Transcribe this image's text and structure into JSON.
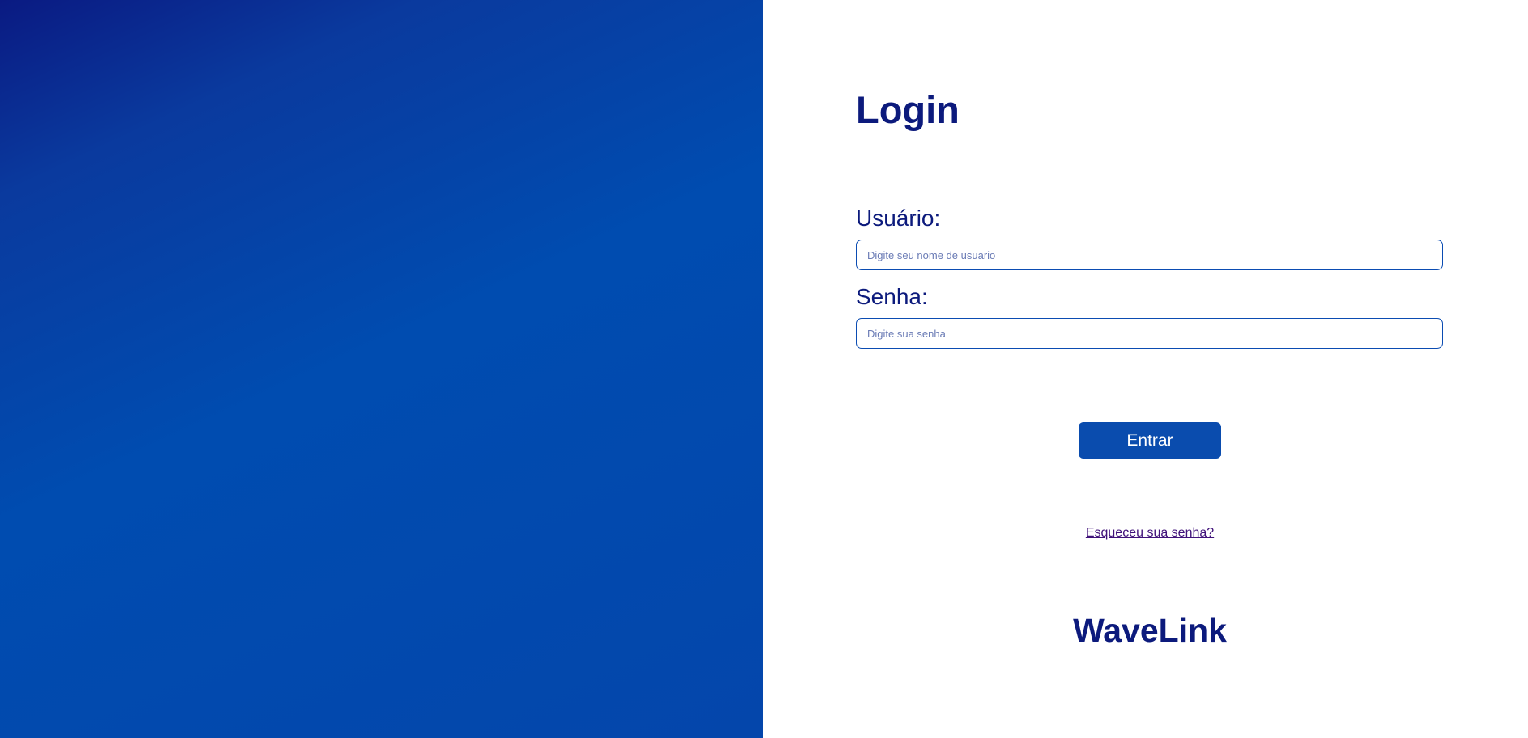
{
  "login": {
    "title": "Login",
    "username": {
      "label": "Usuário:",
      "value": "",
      "placeholder": "Digite seu nome de usuario"
    },
    "password": {
      "label": "Senha:",
      "value": "",
      "placeholder": "Digite sua senha"
    },
    "submit_label": "Entrar",
    "forgot_link": "Esqueceu sua senha?",
    "brand": "WaveLink"
  },
  "colors": {
    "primary_dark": "#0c1a7c",
    "primary": "#0a4cae",
    "gradient_start": "#0a1a82",
    "gradient_end": "#004cb0",
    "link": "#40127a"
  }
}
